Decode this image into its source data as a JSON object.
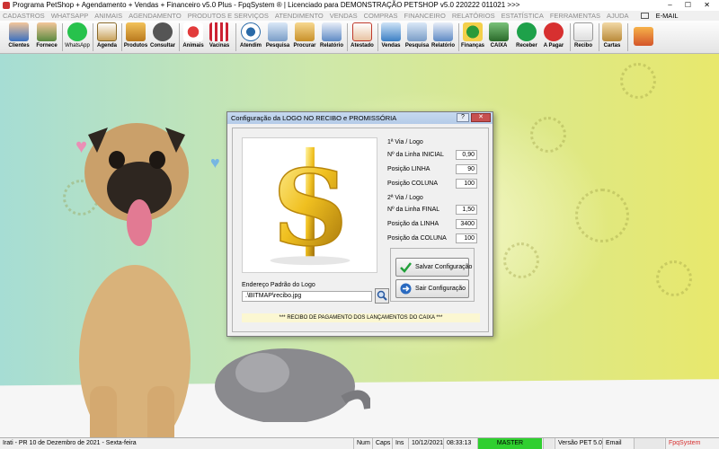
{
  "window": {
    "title": "Programa PetShop + Agendamento + Vendas + Financeiro v5.0 Plus - FpqSystem ® | Licenciado para  DEMONSTRAÇÃO PETSHOP v5.0 220222 011021 >>>",
    "controls": "– ☐ ✕"
  },
  "menu": {
    "items": [
      "CADASTROS",
      "WHATSAPP",
      "ANIMAIS",
      "AGENDAMENTO",
      "PRODUTOS E SERVIÇOS",
      "ATENDIMENTO",
      "VENDAS",
      "COMPRAS",
      "FINANCEIRO",
      "RELATÓRIOS",
      "ESTATÍSTICA",
      "FERRAMENTAS",
      "AJUDA"
    ],
    "email": "E-MAIL"
  },
  "toolbar": {
    "clientes": "Clientes",
    "fornecedores": "Fornece",
    "whatsapp": "WhatsApp",
    "agenda": "Agenda",
    "produtos": "Produtos",
    "consultar": "Consultar",
    "animais": "Animais",
    "vacinas": "Vacinas",
    "atendimento": "Atendim",
    "pesquisa1": "Pesquisa",
    "procurar": "Procurar",
    "relatorio1": "Relatório",
    "atestado": "Atestado",
    "vendas": "Vendas",
    "pesquisa2": "Pesquisa",
    "relatorio2": "Relatório",
    "financas": "Finanças",
    "caixa": "CAIXA",
    "receber": "Receber",
    "apagar": "A Pagar",
    "recibo": "Recibo",
    "cartas": "Cartas",
    "sair": ""
  },
  "dialog": {
    "title": "Configuração da LOGO NO RECIBO e PROMISSÓRIA",
    "help": "?",
    "close": "✕",
    "via1_header": "1ª Via / Logo",
    "via1": {
      "linha_inicial_label": "Nº da Linha INICIAL",
      "linha_inicial": "0,90",
      "posicao_linha_label": "Posição LINHA",
      "posicao_linha": "90",
      "posicao_coluna_label": "Posição COLUNA",
      "posicao_coluna": "100"
    },
    "via2_header": "2ª Via / Logo",
    "via2": {
      "linha_final_label": "Nº da Linha FINAL",
      "linha_final": "1,50",
      "posicao_linha_label": "Posição da LINHA",
      "posicao_linha": "3400",
      "posicao_coluna_label": "Posição da COLUNA",
      "posicao_coluna": "100"
    },
    "endereco_label": "Endereço Padrão do Logo",
    "endereco_value": ".\\BITMAP\\recibo.jpg",
    "salvar_label": "Salvar Configuração",
    "sair_label": "Sair Configuração",
    "banner": "*** RECIBO DE PAGAMENTO DOS LANÇAMENTOS DO CAIXA ***"
  },
  "statusbar": {
    "location_date": "Irati - PR 10 de Dezembro de 2021 - Sexta-feira",
    "num": "Num",
    "caps": "Caps",
    "ins": "Ins",
    "date": "10/12/2021",
    "time": "08:33:13",
    "master": "MASTER",
    "version": "Versão PET 5.0",
    "email": "Email",
    "brand": "FpqSystem"
  },
  "colors": {
    "accent": "#b4cbe8",
    "master": "#2fcf2f",
    "brand": "#d73030"
  }
}
